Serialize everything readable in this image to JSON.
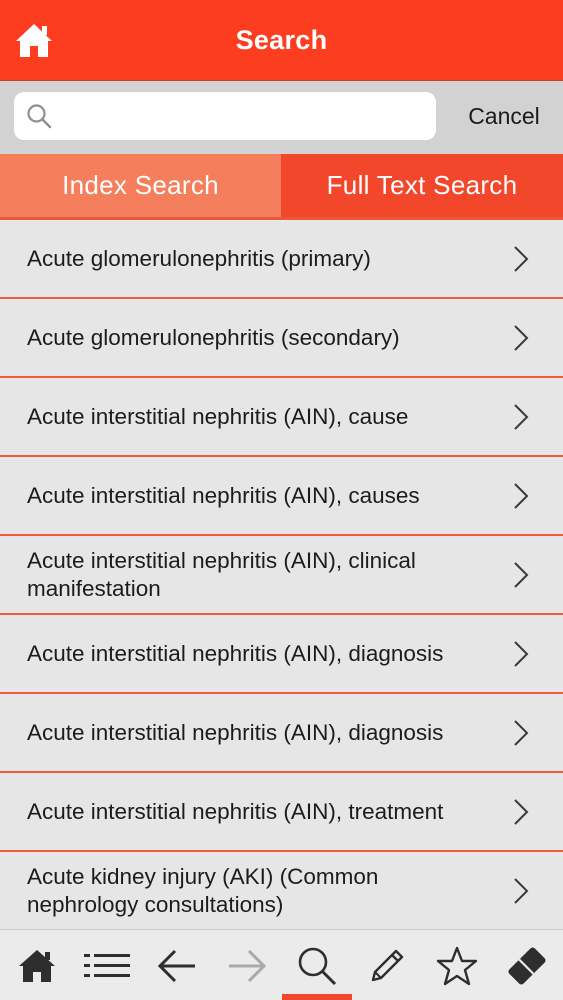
{
  "header": {
    "title": "Search"
  },
  "search": {
    "value": "",
    "placeholder": "",
    "cancel_label": "Cancel"
  },
  "tabs": [
    {
      "label": "Index Search",
      "active": true
    },
    {
      "label": "Full Text Search",
      "active": false
    }
  ],
  "results": [
    "Acute glomerulonephritis (primary)",
    "Acute glomerulonephritis (secondary)",
    "Acute interstitial nephritis (AIN), cause",
    "Acute interstitial nephritis (AIN), causes",
    "Acute interstitial nephritis (AIN), clinical manifestation",
    "Acute interstitial nephritis (AIN), diagnosis",
    "Acute interstitial nephritis (AIN), diagnosis",
    "Acute interstitial nephritis (AIN), treatment",
    "Acute kidney injury (AKI) (Common nephrology consultations)"
  ],
  "toolbar": {
    "items": [
      "home-icon",
      "list-icon",
      "back-arrow-icon",
      "forward-arrow-icon",
      "search-icon",
      "pencil-icon",
      "star-icon",
      "eraser-icon"
    ],
    "active": "search-icon"
  },
  "colors": {
    "accent": "#fc3d1f",
    "tab_index": "#f57e5c",
    "tab_full": "#f3472b",
    "divider": "#f15a3c"
  }
}
